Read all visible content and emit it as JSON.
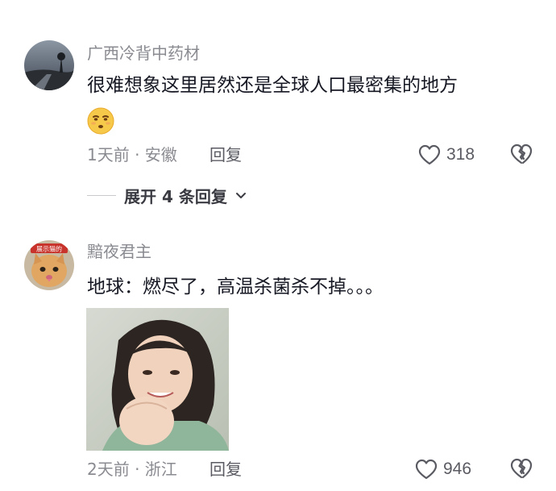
{
  "comments": [
    {
      "username": "广西冷背中药材",
      "text": "很难想象这里居然还是全球人口最密集的地方",
      "emoji": "smirk-face-emoji",
      "meta": "1天前 · 安徽",
      "reply_label": "回复",
      "likes": "318",
      "expand_label": "展开 4 条回复"
    },
    {
      "username": "黯夜君主",
      "avatar_badge": "展示猫的",
      "text": "地球：燃尽了，高温杀菌杀不掉。。。",
      "meta": "2天前 · 浙江",
      "reply_label": "回复",
      "likes": "946"
    }
  ],
  "colors": {
    "primary_text": "#161823",
    "secondary_text": "#8a8b91",
    "icon": "#5a5b62"
  }
}
